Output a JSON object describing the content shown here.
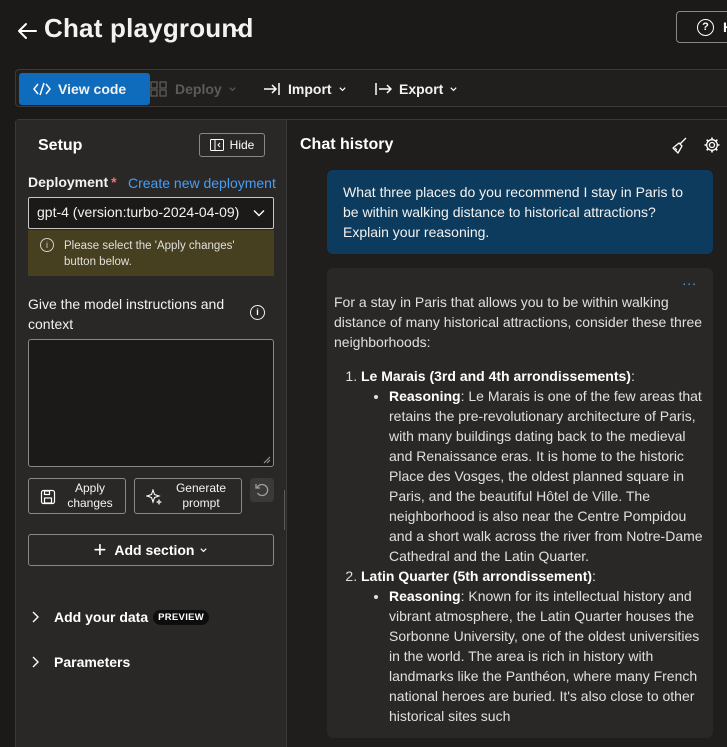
{
  "header": {
    "title": "Chat playground",
    "help_label": "H"
  },
  "toolbar": {
    "view_code": "View code",
    "deploy": "Deploy",
    "import": "Import",
    "export": "Export"
  },
  "setup": {
    "title": "Setup",
    "hide_label": "Hide",
    "deployment_label": "Deployment",
    "required_marker": "*",
    "create_link": "Create new deployment",
    "deployment_value": "gpt-4 (version:turbo-2024-04-09)",
    "warning": "Please select the 'Apply changes' button below.",
    "instructions_label": "Give the model instructions and context",
    "instructions_value": "",
    "apply_label": "Apply changes",
    "generate_label": "Generate prompt",
    "add_section_label": "Add section",
    "add_data_label": "Add your data",
    "preview_badge": "PREVIEW",
    "parameters_label": "Parameters"
  },
  "chat": {
    "title": "Chat history",
    "user_message": "What three places do you recommend I stay in Paris to be within walking distance to historical attractions? Explain your reasoning.",
    "more_label": "...",
    "assistant": {
      "intro": "For a stay in Paris that allows you to be within walking distance of many historical attractions, consider these three neighborhoods:",
      "items": [
        {
          "name": "Le Marais (3rd and 4th arrondissements)",
          "reason_label": "Reasoning",
          "reason": "Le Marais is one of the few areas that retains the pre-revolutionary architecture of Paris, with many buildings dating back to the medieval and Renaissance eras. It is home to the historic Place des Vosges, the oldest planned square in Paris, and the beautiful Hôtel de Ville. The neighborhood is also near the Centre Pompidou and a short walk across the river from Notre-Dame Cathedral and the Latin Quarter."
        },
        {
          "name": "Latin Quarter (5th arrondissement)",
          "reason_label": "Reasoning",
          "reason": "Known for its intellectual history and vibrant atmosphere, the Latin Quarter houses the Sorbonne University, one of the oldest universities in the world. The area is rich in history with landmarks like the Panthéon, where many French national heroes are buried. It's also close to other historical sites such"
        }
      ]
    }
  },
  "colors": {
    "background": "#1b1a19",
    "primary": "#0f6cbd",
    "user_bubble": "#0c3b5e",
    "warning_bg": "#463f20",
    "link": "#479ef5"
  }
}
